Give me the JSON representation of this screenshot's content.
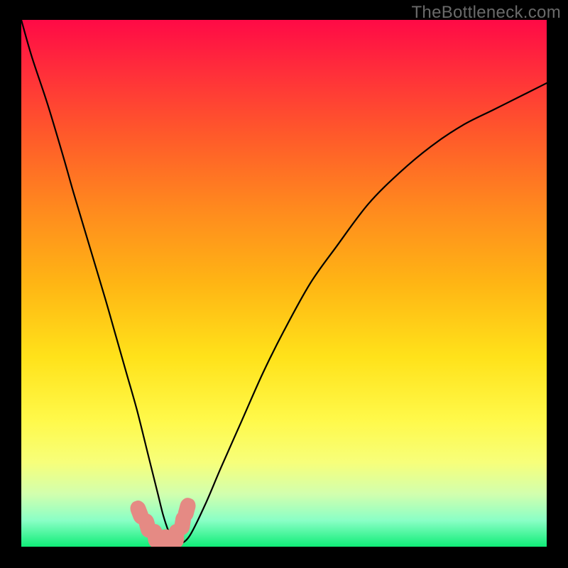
{
  "watermark": "TheBottleneck.com",
  "colors": {
    "background": "#000000",
    "gradient_top": "#ff0a46",
    "gradient_bottom": "#10ed78",
    "curve": "#000000",
    "marker": "#e58a84"
  },
  "chart_data": {
    "type": "line",
    "title": "",
    "xlabel": "",
    "ylabel": "",
    "xlim": [
      0,
      100
    ],
    "ylim": [
      0,
      100
    ],
    "x": [
      0,
      2,
      5,
      8,
      10,
      13,
      16,
      18,
      20,
      22,
      24,
      25,
      26,
      27,
      28,
      29,
      30,
      32,
      35,
      38,
      42,
      46,
      50,
      55,
      60,
      66,
      72,
      78,
      84,
      90,
      96,
      100
    ],
    "y": [
      100,
      93,
      84,
      74,
      67,
      57,
      47,
      40,
      33,
      26,
      18,
      14,
      10,
      6,
      3,
      1,
      0.5,
      2,
      8,
      15,
      24,
      33,
      41,
      50,
      57,
      65,
      71,
      76,
      80,
      83,
      86,
      88
    ],
    "markers_x": [
      22.5,
      24.0,
      25.5,
      27.5,
      29.5,
      30.7,
      31.5
    ],
    "markers_y": [
      6.5,
      4.0,
      2.0,
      1.0,
      2.0,
      4.5,
      7.0
    ],
    "annotations": []
  }
}
